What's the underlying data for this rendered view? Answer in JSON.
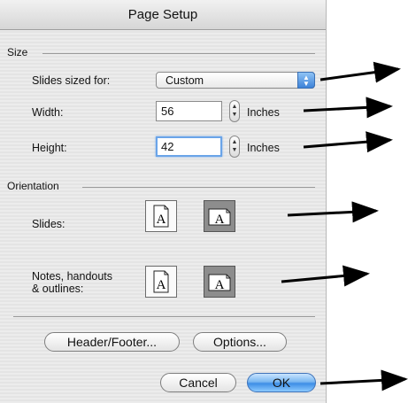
{
  "window": {
    "title": "Page Setup"
  },
  "size": {
    "section_label": "Size",
    "slides_sized_for_label": "Slides sized for:",
    "slides_sized_for_value": "Custom",
    "width_label": "Width:",
    "width_value": "56",
    "width_unit": "Inches",
    "height_label": "Height:",
    "height_value": "42",
    "height_unit": "Inches"
  },
  "orientation": {
    "section_label": "Orientation",
    "slides_label": "Slides:",
    "notes_label_line1": "Notes, handouts",
    "notes_label_line2": "& outlines:",
    "icon_letter": "A",
    "slides_selected": "landscape",
    "notes_selected": "landscape"
  },
  "buttons": {
    "header_footer": "Header/Footer...",
    "options": "Options...",
    "cancel": "Cancel",
    "ok": "OK"
  },
  "annotations": {
    "arrow_color": "#000000",
    "count": 6
  }
}
